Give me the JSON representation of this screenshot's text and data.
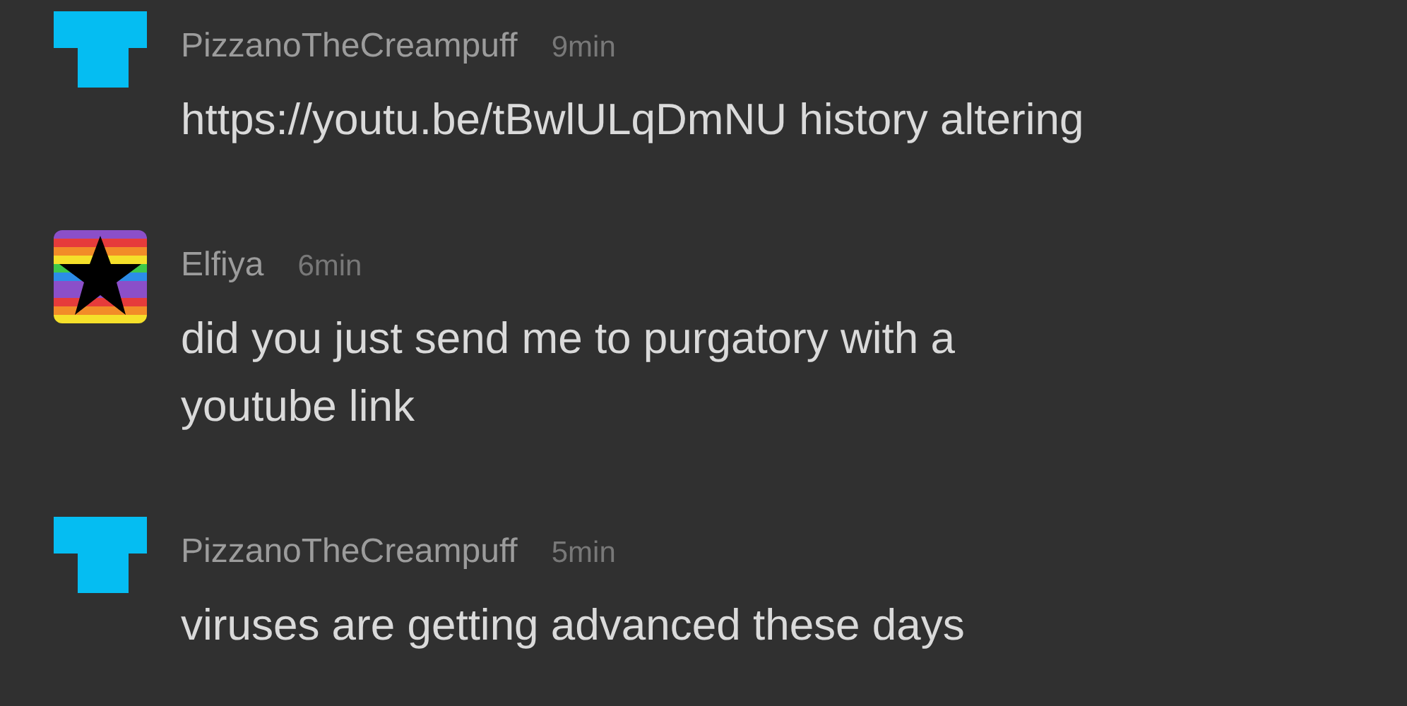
{
  "messages": [
    {
      "avatar": {
        "kind": "t-shape"
      },
      "author": "PizzanoTheCreampuff",
      "time": "9min",
      "lines": [
        "https://youtu.be/tBwlULqDmNU history altering"
      ]
    },
    {
      "avatar": {
        "kind": "rainbow-star"
      },
      "author": "Elfiya",
      "time": "6min",
      "lines": [
        "did you just send me to purgatory with a",
        "youtube link"
      ]
    },
    {
      "avatar": {
        "kind": "t-shape"
      },
      "author": "PizzanoTheCreampuff",
      "time": "5min",
      "lines": [
        "viruses are getting advanced these days"
      ]
    }
  ]
}
